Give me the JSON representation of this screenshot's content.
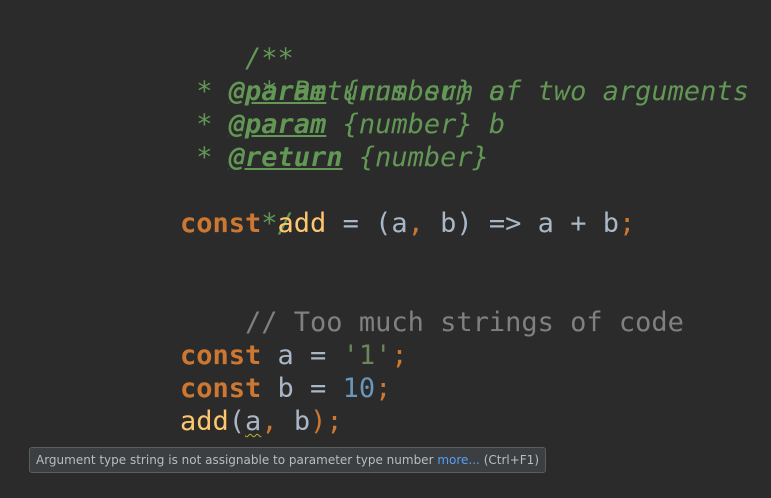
{
  "code": {
    "l1": {
      "t1": "/**"
    },
    "l2": {
      "t1": " * Returns sum of two arguments"
    },
    "l3": {
      "t1": " * ",
      "tag": "@param",
      "t2": " {number} a"
    },
    "l4": {
      "t1": " * ",
      "tag": "@param",
      "t2": " {number} b"
    },
    "l5": {
      "t1": " * ",
      "tag": "@return",
      "t2": " {number}"
    },
    "l6": {
      "t1": " */"
    },
    "l7": {
      "kw": "const",
      "fn": "add",
      "op1": " = (",
      "p1": "a",
      "comma": ",",
      "p2": " b) => a + b",
      "semi": ";"
    },
    "l9": {
      "comment": "// Too much strings of code"
    },
    "l11": {
      "kw": "const",
      "id": " a = ",
      "str": "'1'",
      "semi": ";"
    },
    "l12": {
      "kw": "const",
      "id": " b = ",
      "num": "10",
      "semi": ";"
    },
    "l13": {
      "fn": "add",
      "open": "(",
      "arg1": "a",
      "comma": ",",
      "arg2": " b",
      "close": ")",
      "semi": ";"
    }
  },
  "tooltip": {
    "message": "Argument type string is not assignable to parameter type number",
    "more_link": "more...",
    "shortcut": "(Ctrl+F1)"
  }
}
